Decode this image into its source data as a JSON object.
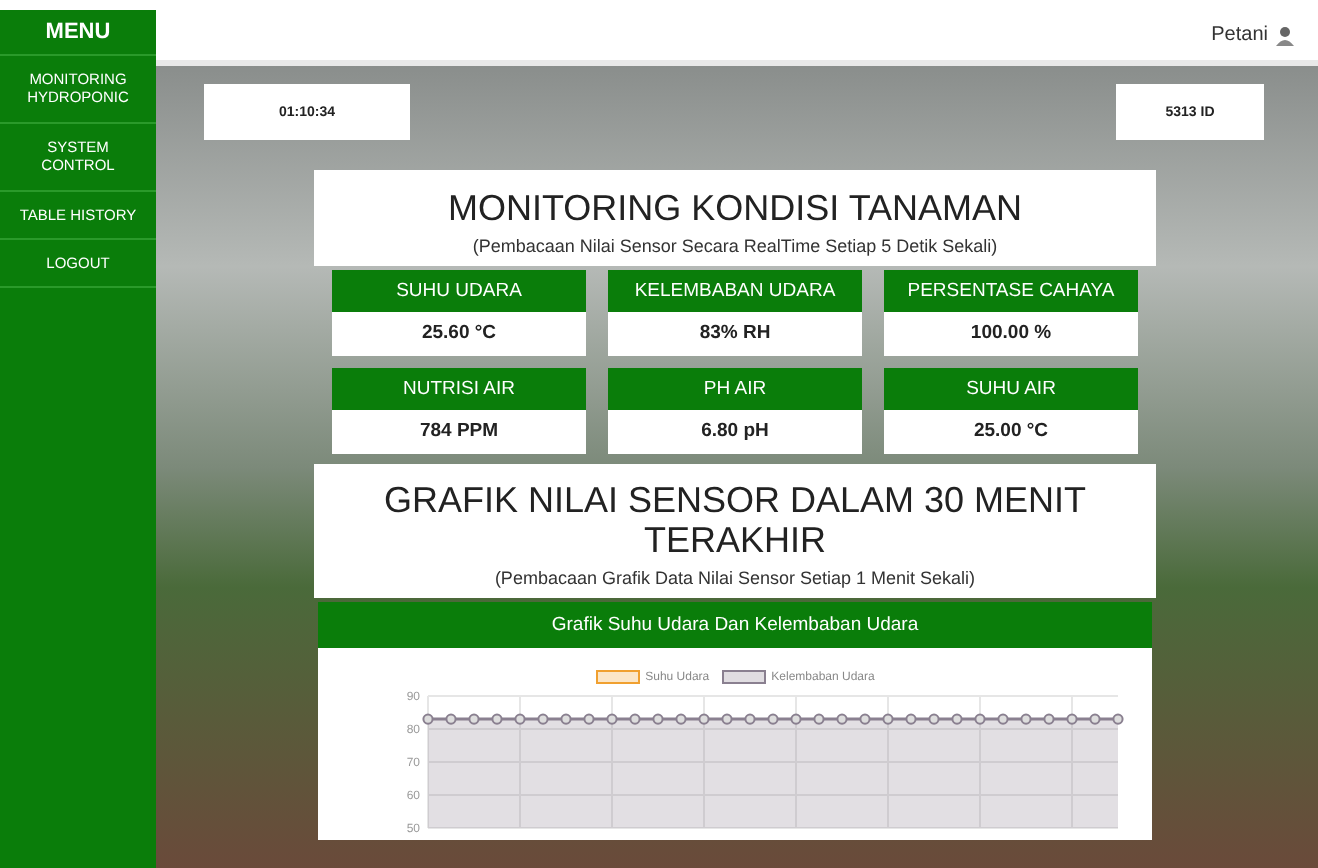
{
  "sidebar": {
    "title": "MENU",
    "items": [
      {
        "label": "MONITORING HYDROPONIC",
        "selected": false
      },
      {
        "label": "SYSTEM CONTROL",
        "selected": false
      },
      {
        "label": "TABLE HISTORY",
        "selected": false
      },
      {
        "label": "LOGOUT",
        "selected": false
      }
    ]
  },
  "header": {
    "user": "Petani"
  },
  "clock": "01:10:34",
  "device_id": "5313 ID",
  "monitoring": {
    "title": "MONITORING KONDISI TANAMAN",
    "subtitle": "(Pembacaan Nilai Sensor Secara RealTime Setiap 5 Detik Sekali)",
    "sensors": [
      {
        "label": "SUHU UDARA",
        "value": "25.60 °C"
      },
      {
        "label": "KELEMBABAN UDARA",
        "value": "83% RH"
      },
      {
        "label": "PERSENTASE CAHAYA",
        "value": "100.00 %"
      },
      {
        "label": "NUTRISI AIR",
        "value": "784 PPM"
      },
      {
        "label": "PH AIR",
        "value": "6.80 pH"
      },
      {
        "label": "SUHU AIR",
        "value": "25.00 °C"
      }
    ]
  },
  "graph_section": {
    "title": "GRAFIK NILAI SENSOR DALAM 30 MENIT TERAKHIR",
    "subtitle": "(Pembacaan Grafik Data Nilai Sensor Setiap 1 Menit Sekali)",
    "chart_card": {
      "title": "Grafik Suhu Udara Dan Kelembaban Udara",
      "chart_data": {
        "type": "area",
        "grid": true,
        "ylim": [
          50,
          90
        ],
        "yticks": [
          50,
          60,
          70,
          80,
          90
        ],
        "series": [
          {
            "name": "Suhu Udara",
            "color": "#f0a030",
            "values": [
              null,
              null,
              null,
              null,
              null,
              null,
              null,
              null,
              null,
              null,
              null,
              null,
              null,
              null,
              null,
              null,
              null,
              null,
              null,
              null,
              null,
              null,
              null,
              null,
              null,
              null,
              null,
              null,
              null,
              null,
              null
            ]
          },
          {
            "name": "Kelembaban Udara",
            "color": "#8a8090",
            "values": [
              83,
              83,
              83,
              83,
              83,
              83,
              83,
              83,
              83,
              83,
              83,
              83,
              83,
              83,
              83,
              83,
              83,
              83,
              83,
              83,
              83,
              83,
              83,
              83,
              83,
              83,
              83,
              83,
              83,
              83,
              83
            ]
          }
        ]
      }
    }
  }
}
